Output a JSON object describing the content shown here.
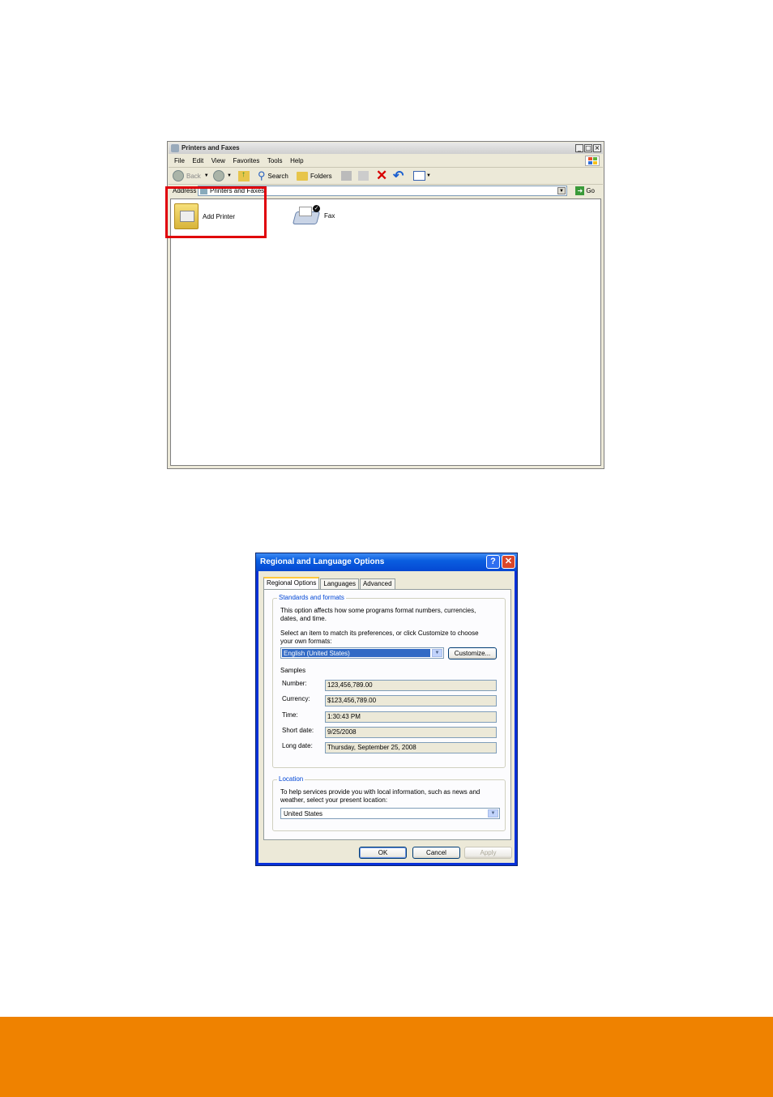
{
  "explorer": {
    "title": "Printers and Faxes",
    "menu": [
      "File",
      "Edit",
      "View",
      "Favorites",
      "Tools",
      "Help"
    ],
    "toolbar": {
      "back": "Back",
      "search": "Search",
      "folders": "Folders"
    },
    "address": {
      "label": "Address",
      "value": "Printers and Faxes",
      "go": "Go"
    },
    "items": [
      {
        "label": "Add Printer",
        "icon": "add-printer-icon"
      },
      {
        "label": "Fax",
        "icon": "fax-icon"
      }
    ]
  },
  "dialog": {
    "title": "Regional and Language Options",
    "tabs": [
      "Regional Options",
      "Languages",
      "Advanced"
    ],
    "standards": {
      "legend": "Standards and formats",
      "desc1": "This option affects how some programs format numbers, currencies,",
      "desc2": "dates, and time.",
      "select1": "Select an item to match its preferences, or click Customize to choose",
      "select2": "your own formats:",
      "selected_format": "English (United States)",
      "customize": "Customize...",
      "samples_label": "Samples",
      "samples": [
        {
          "label": "Number:",
          "value": "123,456,789.00"
        },
        {
          "label": "Currency:",
          "value": "$123,456,789.00"
        },
        {
          "label": "Time:",
          "value": "1:30:43 PM"
        },
        {
          "label": "Short date:",
          "value": "9/25/2008"
        },
        {
          "label": "Long date:",
          "value": "Thursday, September 25, 2008"
        }
      ]
    },
    "location": {
      "legend": "Location",
      "desc1": "To help services provide you with local information, such as news and",
      "desc2": "weather, select your present location:",
      "selected": "United States"
    },
    "buttons": {
      "ok": "OK",
      "cancel": "Cancel",
      "apply": "Apply"
    }
  },
  "colors": {
    "highlight": "#e0000a",
    "footer": "#ef8200",
    "xp_blue": "#0548d2"
  }
}
